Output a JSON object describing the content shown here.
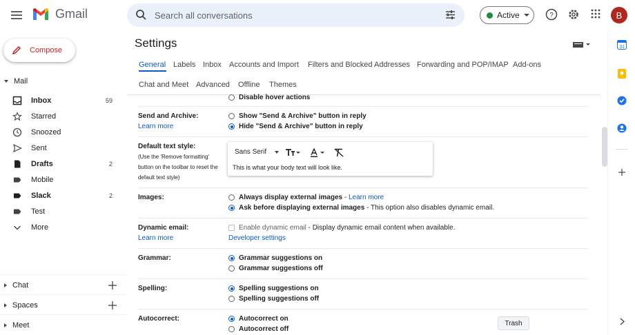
{
  "app": {
    "name": "Gmail",
    "avatar_letter": "B"
  },
  "search": {
    "placeholder": "Search all conversations"
  },
  "status": {
    "label": "Active"
  },
  "compose": {
    "label": "Compose"
  },
  "sidebar": {
    "mail_label": "Mail",
    "items": [
      {
        "label": "Inbox",
        "count": "59",
        "icon": "inbox-icon"
      },
      {
        "label": "Starred",
        "count": "",
        "icon": "star-icon"
      },
      {
        "label": "Snoozed",
        "count": "",
        "icon": "clock-icon"
      },
      {
        "label": "Sent",
        "count": "",
        "icon": "send-icon"
      },
      {
        "label": "Drafts",
        "count": "2",
        "icon": "draft-icon"
      },
      {
        "label": "Mobile",
        "count": "",
        "icon": "label-icon"
      },
      {
        "label": "Slack",
        "count": "2",
        "icon": "label-icon"
      },
      {
        "label": "Test",
        "count": "",
        "icon": "label-icon"
      },
      {
        "label": "More",
        "count": "",
        "icon": "chevron-down-icon"
      }
    ],
    "chat_label": "Chat",
    "spaces_label": "Spaces",
    "meet_label": "Meet"
  },
  "settings": {
    "title": "Settings",
    "tabs": [
      "General",
      "Labels",
      "Inbox",
      "Accounts and Import",
      "Filters and Blocked Addresses",
      "Forwarding and POP/IMAP",
      "Add-ons",
      "Chat and Meet",
      "Advanced",
      "Offline",
      "Themes"
    ],
    "rows": {
      "hover": {
        "option": "Disable hover actions"
      },
      "send_archive": {
        "label": "Send and Archive:",
        "link": "Learn more",
        "opt1": "Show \"Send & Archive\" button in reply",
        "opt2": "Hide \"Send & Archive\" button in reply"
      },
      "text_style": {
        "label": "Default text style:",
        "note": "(Use the 'Remove formatting' button on the toolbar to reset the default text style)",
        "font": "Sans Serif",
        "sample": "This is what your body text will look like."
      },
      "images": {
        "label": "Images:",
        "opt1": "Always display external images",
        "opt1_sep": " - ",
        "opt1_link": "Learn more",
        "opt2": "Ask before displaying external images",
        "opt2_note": " - This option also disables dynamic email."
      },
      "dynamic": {
        "label": "Dynamic email:",
        "link": "Learn more",
        "opt": "Enable dynamic email",
        "opt_note": " - Display dynamic email content when available.",
        "dev": "Developer settings"
      },
      "grammar": {
        "label": "Grammar:",
        "opt1": "Grammar suggestions on",
        "opt2": "Grammar suggestions off"
      },
      "spelling": {
        "label": "Spelling:",
        "opt1": "Spelling suggestions on",
        "opt2": "Spelling suggestions off"
      },
      "autocorrect": {
        "label": "Autocorrect:",
        "opt1": "Autocorrect on",
        "opt2": "Autocorrect off"
      }
    }
  },
  "tooltip": {
    "text": "Trash"
  },
  "colors": {
    "accent": "#0b57d0",
    "compose": "#c5221f",
    "avatar": "#b3261e",
    "active": "#1e8e3e"
  }
}
